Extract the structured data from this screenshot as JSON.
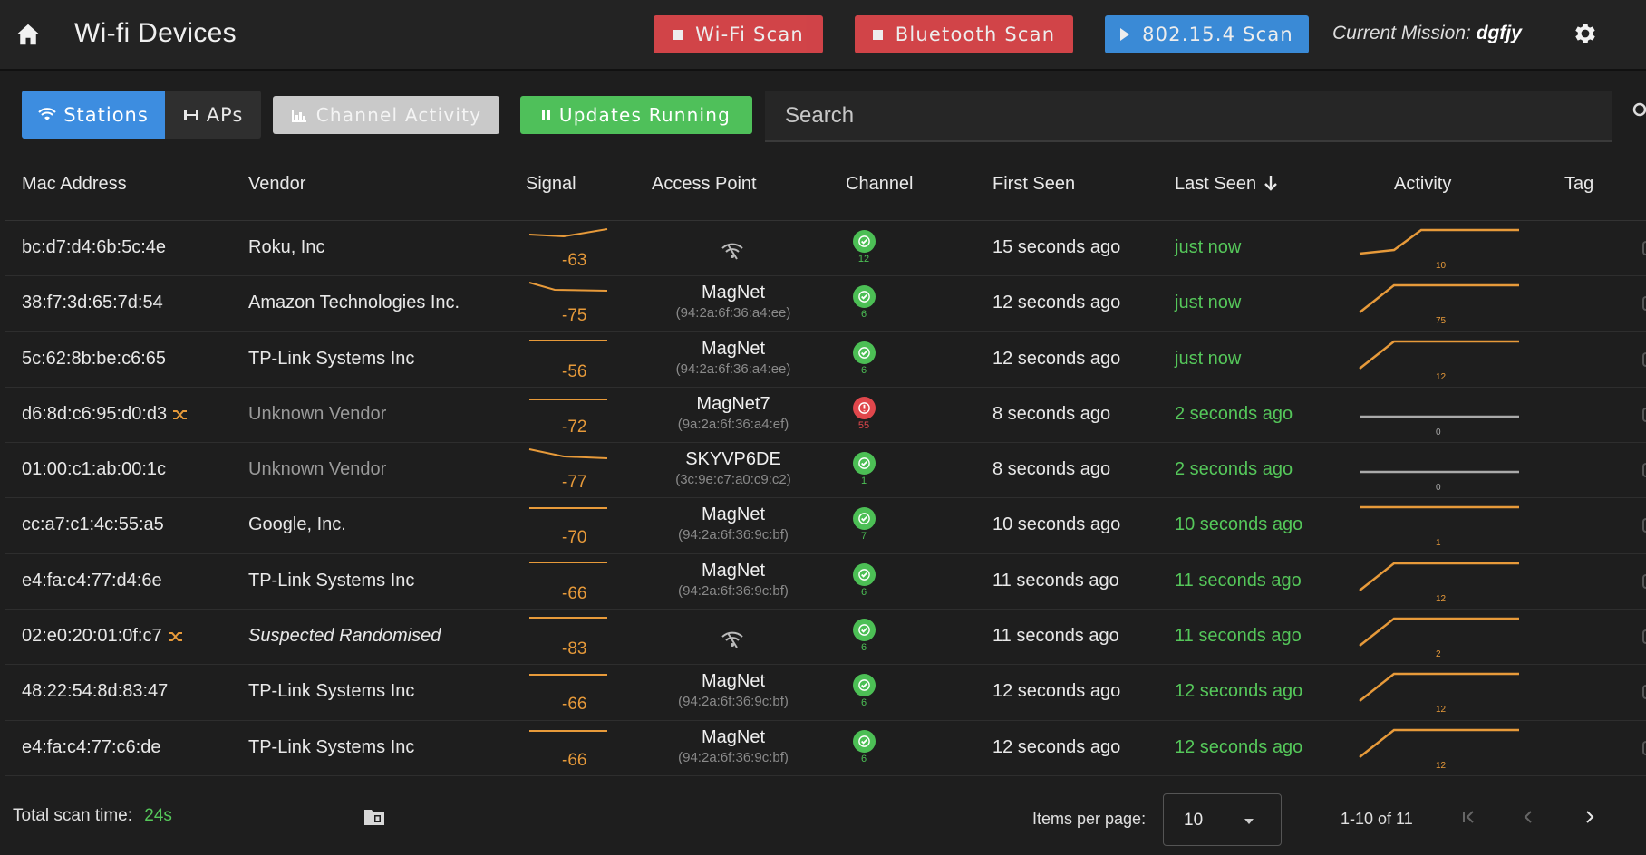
{
  "header": {
    "title": "Wi-fi Devices",
    "home_icon": "home-icon",
    "wifi_scan_label": "Wi-Fi Scan",
    "bluetooth_scan_label": "Bluetooth Scan",
    "zigbee_scan_label": "802.15.4 Scan",
    "mission_label": "Current Mission:",
    "mission_value": "dgfjy",
    "settings_icon": "gear-icon",
    "colors": {
      "stop": "#e0474c",
      "start": "#3c93e6"
    }
  },
  "toolbar": {
    "stations_label": "Stations",
    "aps_label": "APs",
    "channel_activity_label": "Channel Activity",
    "updates_label": "Updates Running",
    "search_placeholder": "Search"
  },
  "table": {
    "columns": [
      "Mac Address",
      "Vendor",
      "Signal",
      "Access Point",
      "Channel",
      "First Seen",
      "Last Seen",
      "Activity",
      "Tag"
    ],
    "sort_column": "Last Seen",
    "rows": [
      {
        "mac": "bc:d7:d4:6b:5c:4e",
        "vendor": "Roku, Inc",
        "signal": "-63",
        "ap_name": "",
        "ap_mac": "",
        "channel": "12",
        "first_seen": "15 seconds ago",
        "last_seen": "just now",
        "activity": "10"
      },
      {
        "mac": "38:f7:3d:65:7d:54",
        "vendor": "Amazon Technologies Inc.",
        "signal": "-75",
        "ap_name": "MagNet",
        "ap_mac": "(94:2a:6f:36:a4:ee)",
        "channel": "6",
        "first_seen": "12 seconds ago",
        "last_seen": "just now",
        "activity": "75"
      },
      {
        "mac": "5c:62:8b:be:c6:65",
        "vendor": "TP-Link Systems Inc",
        "signal": "-56",
        "ap_name": "MagNet",
        "ap_mac": "(94:2a:6f:36:a4:ee)",
        "channel": "6",
        "first_seen": "12 seconds ago",
        "last_seen": "just now",
        "activity": "12"
      },
      {
        "mac": "d6:8d:c6:95:d0:d3",
        "vendor": "Unknown Vendor",
        "signal": "-72",
        "ap_name": "MagNet7",
        "ap_mac": "(9a:2a:6f:36:a4:ef)",
        "channel": "55",
        "first_seen": "8 seconds ago",
        "last_seen": "2 seconds ago",
        "activity": "0"
      },
      {
        "mac": "01:00:c1:ab:00:1c",
        "vendor": "Unknown Vendor",
        "signal": "-77",
        "ap_name": "SKYVP6DE",
        "ap_mac": "(3c:9e:c7:a0:c9:c2)",
        "channel": "1",
        "first_seen": "8 seconds ago",
        "last_seen": "2 seconds ago",
        "activity": "0"
      },
      {
        "mac": "cc:a7:c1:4c:55:a5",
        "vendor": "Google, Inc.",
        "signal": "-70",
        "ap_name": "MagNet",
        "ap_mac": "(94:2a:6f:36:9c:bf)",
        "channel": "7",
        "first_seen": "10 seconds ago",
        "last_seen": "10 seconds ago",
        "activity": "1"
      },
      {
        "mac": "e4:fa:c4:77:d4:6e",
        "vendor": "TP-Link Systems Inc",
        "signal": "-66",
        "ap_name": "MagNet",
        "ap_mac": "(94:2a:6f:36:9c:bf)",
        "channel": "6",
        "first_seen": "11 seconds ago",
        "last_seen": "11 seconds ago",
        "activity": "12"
      },
      {
        "mac": "02:e0:20:01:0f:c7",
        "vendor": "Suspected Randomised",
        "signal": "-83",
        "ap_name": "",
        "ap_mac": "",
        "channel": "6",
        "first_seen": "11 seconds ago",
        "last_seen": "11 seconds ago",
        "activity": "2"
      },
      {
        "mac": "48:22:54:8d:83:47",
        "vendor": "TP-Link Systems Inc",
        "signal": "-66",
        "ap_name": "MagNet",
        "ap_mac": "(94:2a:6f:36:9c:bf)",
        "channel": "6",
        "first_seen": "12 seconds ago",
        "last_seen": "12 seconds ago",
        "activity": "12"
      },
      {
        "mac": "e4:fa:c4:77:c6:de",
        "vendor": "TP-Link Systems Inc",
        "signal": "-66",
        "ap_name": "MagNet",
        "ap_mac": "(94:2a:6f:36:9c:bf)",
        "channel": "6",
        "first_seen": "12 seconds ago",
        "last_seen": "12 seconds ago",
        "activity": "12"
      }
    ]
  },
  "footer": {
    "total_label": "Total scan time:",
    "total_value": "24s",
    "items_per_page_label": "Items per page:",
    "items_per_page_value": "10",
    "range_label": "1-10 of 11"
  }
}
